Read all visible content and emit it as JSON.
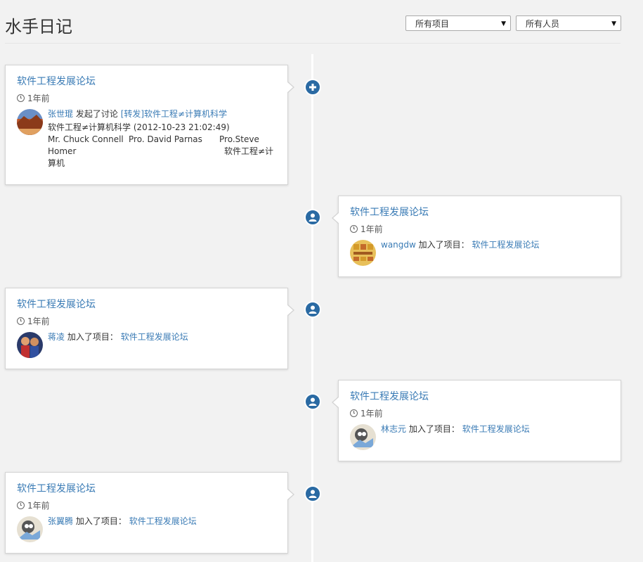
{
  "page": {
    "title": "水手日记",
    "filter_project": "所有项目",
    "filter_people": "所有人员"
  },
  "colors": {
    "accent": "#3a7bb5",
    "node": "#2a6aa3",
    "background": "#f2f2f2"
  },
  "events": [
    {
      "project": "软件工程发展论坛",
      "time": "1年前",
      "user": "张世琨",
      "action": "发起了讨论",
      "target": "[转发]软件工程≠计算机科学",
      "detail_line1": "软件工程≠计算机科学 (2012-10-23 21:02:49)",
      "detail_line2a": "Mr. Chuck Connell",
      "detail_line2b": "Pro. David Parnas",
      "detail_line2c": "Pro.Steve",
      "detail_line3a": "Homer",
      "detail_line3b": "软件工程≠计",
      "detail_line4": "算机",
      "icon": "plus-icon"
    },
    {
      "project": "软件工程发展论坛",
      "time": "1年前",
      "user": "wangdw",
      "action": "加入了项目：",
      "target": "软件工程发展论坛",
      "icon": "user-icon"
    },
    {
      "project": "软件工程发展论坛",
      "time": "1年前",
      "user": "蒋凌",
      "action": "加入了项目：",
      "target": "软件工程发展论坛",
      "icon": "user-icon"
    },
    {
      "project": "软件工程发展论坛",
      "time": "1年前",
      "user": "林志元",
      "action": "加入了项目：",
      "target": "软件工程发展论坛",
      "icon": "user-icon"
    },
    {
      "project": "软件工程发展论坛",
      "time": "1年前",
      "user": "张翼腾",
      "action": "加入了项目：",
      "target": "软件工程发展论坛",
      "icon": "user-icon"
    }
  ]
}
